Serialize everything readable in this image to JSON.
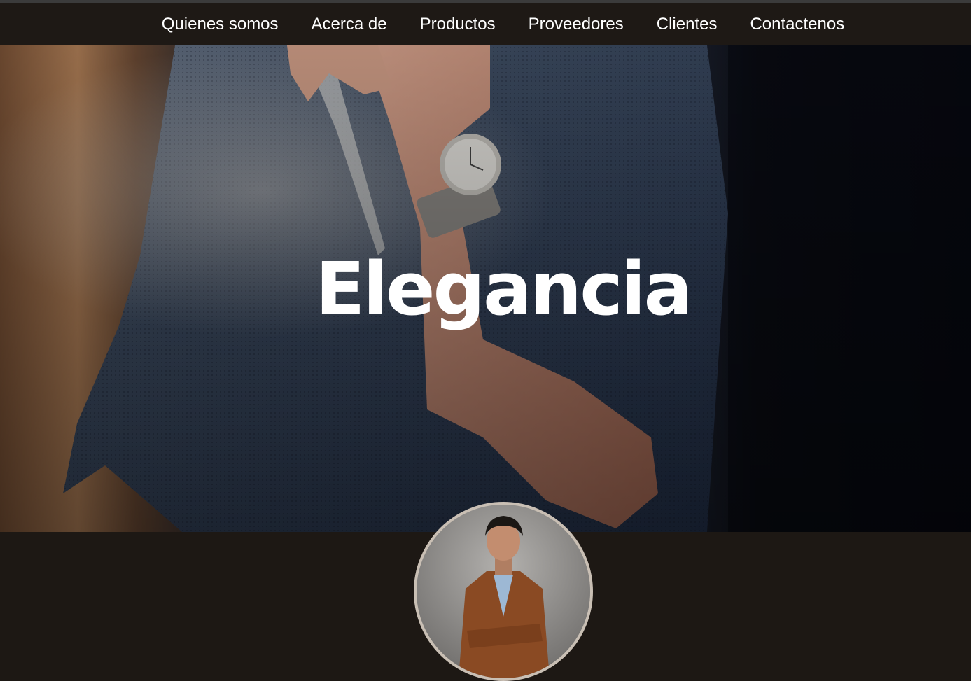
{
  "nav": {
    "items": [
      {
        "label": "Quienes somos"
      },
      {
        "label": "Acerca de"
      },
      {
        "label": "Productos"
      },
      {
        "label": "Proveedores"
      },
      {
        "label": "Clientes"
      },
      {
        "label": "Contactenos"
      }
    ]
  },
  "hero": {
    "title": "Elegancia",
    "image_icon": "man-with-watch-photo"
  },
  "profile": {
    "avatar_icon": "person-portrait-photo"
  },
  "colors": {
    "navbar_bg": "#1e1915",
    "page_bg": "#1d1814",
    "text": "#ffffff",
    "avatar_border": "#c9bfb4"
  }
}
